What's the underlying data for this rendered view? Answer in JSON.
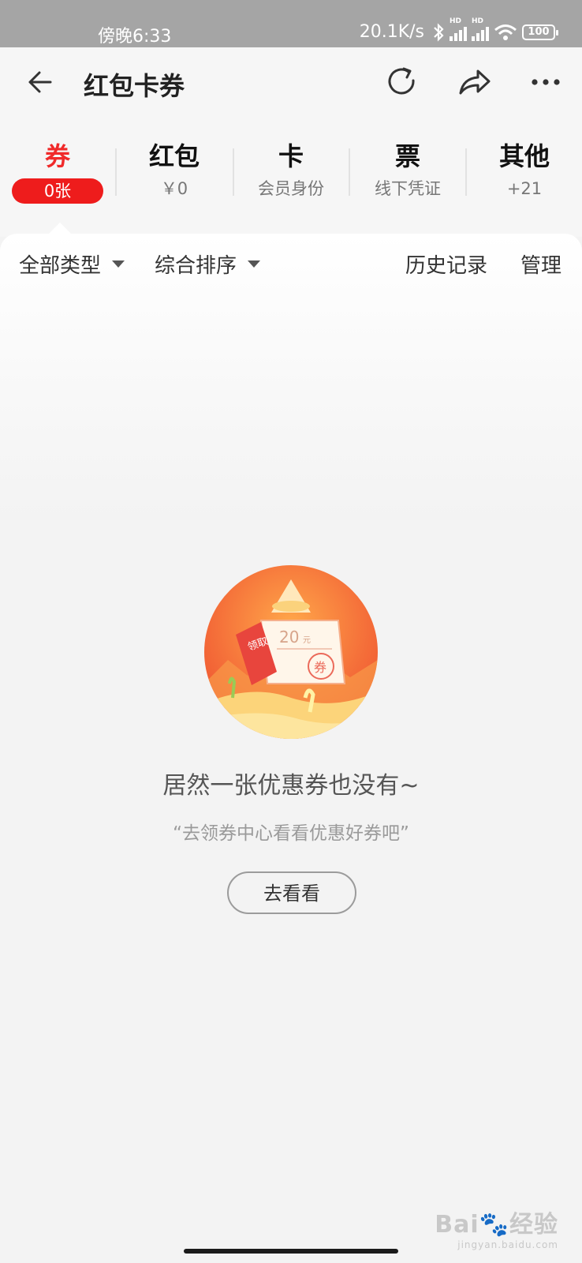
{
  "status_bar": {
    "time": "傍晚6:33",
    "network_speed": "20.1K/s",
    "signal_label": "HD",
    "battery": "100"
  },
  "header": {
    "title": "红包卡券",
    "icons": [
      "back-icon",
      "refresh-icon",
      "share-icon",
      "more-icon"
    ]
  },
  "tabs": [
    {
      "title": "券",
      "sub": "0张"
    },
    {
      "title": "红包",
      "sub": "￥0"
    },
    {
      "title": "卡",
      "sub": "会员身份"
    },
    {
      "title": "票",
      "sub": "线下凭证"
    },
    {
      "title": "其他",
      "sub": "+21"
    }
  ],
  "filters": {
    "type": "全部类型",
    "sort": "综合排序",
    "history": "历史记录",
    "manage": "管理"
  },
  "empty_state": {
    "badge_text": "领取",
    "coupon_value": "20",
    "coupon_unit": "元",
    "coupon_stamp": "券",
    "title": "居然一张优惠券也没有~",
    "subtitle": "“去领券中心看看优惠好券吧”",
    "button": "去看看"
  },
  "watermark": {
    "brand": "Bai",
    "brand_cn": "经验",
    "url": "jingyan.baidu.com"
  },
  "colors": {
    "accent": "#ee1c1c",
    "status_bar": "#a5a5a5",
    "background": "#f3f3f3"
  }
}
